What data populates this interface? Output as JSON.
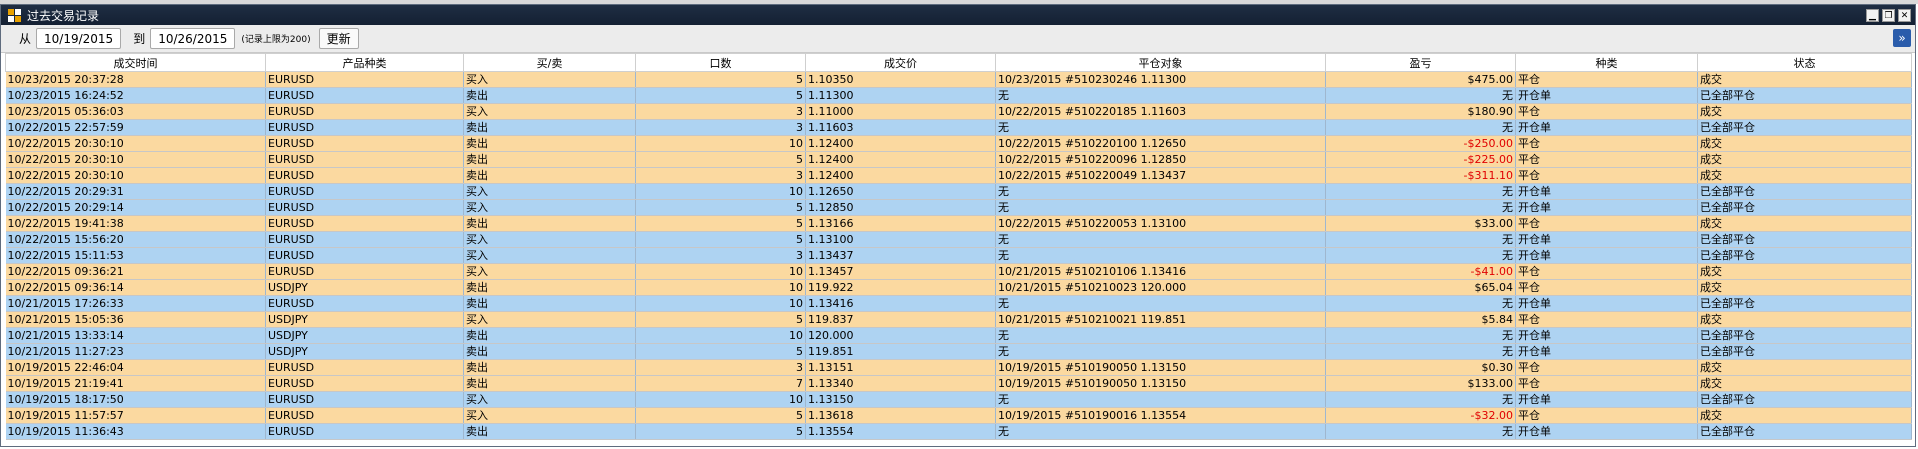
{
  "window": {
    "title": "过去交易记录"
  },
  "toolbar": {
    "from_label": "从",
    "from_date": "10/19/2015",
    "to_label": "到",
    "to_date": "10/26/2015",
    "limit_note": "(记录上限为200)",
    "refresh_label": "更新"
  },
  "table": {
    "columns": [
      "成交时间",
      "产品种类",
      "买/卖",
      "口数",
      "成交价",
      "平仓对象",
      "盈亏",
      "种类",
      "状态"
    ],
    "rows": [
      [
        "10/23/2015 20:37:28",
        "EURUSD",
        "买入",
        "5",
        "1.10350",
        "10/23/2015 #510230246 1.11300",
        "$475.00",
        "平仓",
        "成交"
      ],
      [
        "10/23/2015 16:24:52",
        "EURUSD",
        "卖出",
        "5",
        "1.11300",
        "无",
        "无",
        "开仓单",
        "已全部平仓"
      ],
      [
        "10/23/2015 05:36:03",
        "EURUSD",
        "买入",
        "3",
        "1.11000",
        "10/22/2015 #510220185 1.11603",
        "$180.90",
        "平仓",
        "成交"
      ],
      [
        "10/22/2015 22:57:59",
        "EURUSD",
        "卖出",
        "3",
        "1.11603",
        "无",
        "无",
        "开仓单",
        "已全部平仓"
      ],
      [
        "10/22/2015 20:30:10",
        "EURUSD",
        "卖出",
        "10",
        "1.12400",
        "10/22/2015 #510220100 1.12650",
        "-$250.00",
        "平仓",
        "成交"
      ],
      [
        "10/22/2015 20:30:10",
        "EURUSD",
        "卖出",
        "5",
        "1.12400",
        "10/22/2015 #510220096 1.12850",
        "-$225.00",
        "平仓",
        "成交"
      ],
      [
        "10/22/2015 20:30:10",
        "EURUSD",
        "卖出",
        "3",
        "1.12400",
        "10/22/2015 #510220049 1.13437",
        "-$311.10",
        "平仓",
        "成交"
      ],
      [
        "10/22/2015 20:29:31",
        "EURUSD",
        "买入",
        "10",
        "1.12650",
        "无",
        "无",
        "开仓单",
        "已全部平仓"
      ],
      [
        "10/22/2015 20:29:14",
        "EURUSD",
        "买入",
        "5",
        "1.12850",
        "无",
        "无",
        "开仓单",
        "已全部平仓"
      ],
      [
        "10/22/2015 19:41:38",
        "EURUSD",
        "卖出",
        "5",
        "1.13166",
        "10/22/2015 #510220053 1.13100",
        "$33.00",
        "平仓",
        "成交"
      ],
      [
        "10/22/2015 15:56:20",
        "EURUSD",
        "买入",
        "5",
        "1.13100",
        "无",
        "无",
        "开仓单",
        "已全部平仓"
      ],
      [
        "10/22/2015 15:11:53",
        "EURUSD",
        "买入",
        "3",
        "1.13437",
        "无",
        "无",
        "开仓单",
        "已全部平仓"
      ],
      [
        "10/22/2015 09:36:21",
        "EURUSD",
        "买入",
        "10",
        "1.13457",
        "10/21/2015 #510210106 1.13416",
        "-$41.00",
        "平仓",
        "成交"
      ],
      [
        "10/22/2015 09:36:14",
        "USDJPY",
        "卖出",
        "10",
        "119.922",
        "10/21/2015 #510210023 120.000",
        "$65.04",
        "平仓",
        "成交"
      ],
      [
        "10/21/2015 17:26:33",
        "EURUSD",
        "卖出",
        "10",
        "1.13416",
        "无",
        "无",
        "开仓单",
        "已全部平仓"
      ],
      [
        "10/21/2015 15:05:36",
        "USDJPY",
        "买入",
        "5",
        "119.837",
        "10/21/2015 #510210021 119.851",
        "$5.84",
        "平仓",
        "成交"
      ],
      [
        "10/21/2015 13:33:14",
        "USDJPY",
        "卖出",
        "10",
        "120.000",
        "无",
        "无",
        "开仓单",
        "已全部平仓"
      ],
      [
        "10/21/2015 11:27:23",
        "USDJPY",
        "卖出",
        "5",
        "119.851",
        "无",
        "无",
        "开仓单",
        "已全部平仓"
      ],
      [
        "10/19/2015 22:46:04",
        "EURUSD",
        "卖出",
        "3",
        "1.13151",
        "10/19/2015 #510190050 1.13150",
        "$0.30",
        "平仓",
        "成交"
      ],
      [
        "10/19/2015 21:19:41",
        "EURUSD",
        "卖出",
        "7",
        "1.13340",
        "10/19/2015 #510190050 1.13150",
        "$133.00",
        "平仓",
        "成交"
      ],
      [
        "10/19/2015 18:17:50",
        "EURUSD",
        "买入",
        "10",
        "1.13150",
        "无",
        "无",
        "开仓单",
        "已全部平仓"
      ],
      [
        "10/19/2015 11:57:57",
        "EURUSD",
        "买入",
        "5",
        "1.13618",
        "10/19/2015 #510190016 1.13554",
        "-$32.00",
        "平仓",
        "成交"
      ],
      [
        "10/19/2015 11:36:43",
        "EURUSD",
        "卖出",
        "5",
        "1.13554",
        "无",
        "无",
        "开仓单",
        "已全部平仓"
      ]
    ]
  },
  "colors": {
    "close_row": "#fbd9a0",
    "open_row": "#aed3f2",
    "negative": "#e00000",
    "titlebar": "#1f2e43"
  }
}
